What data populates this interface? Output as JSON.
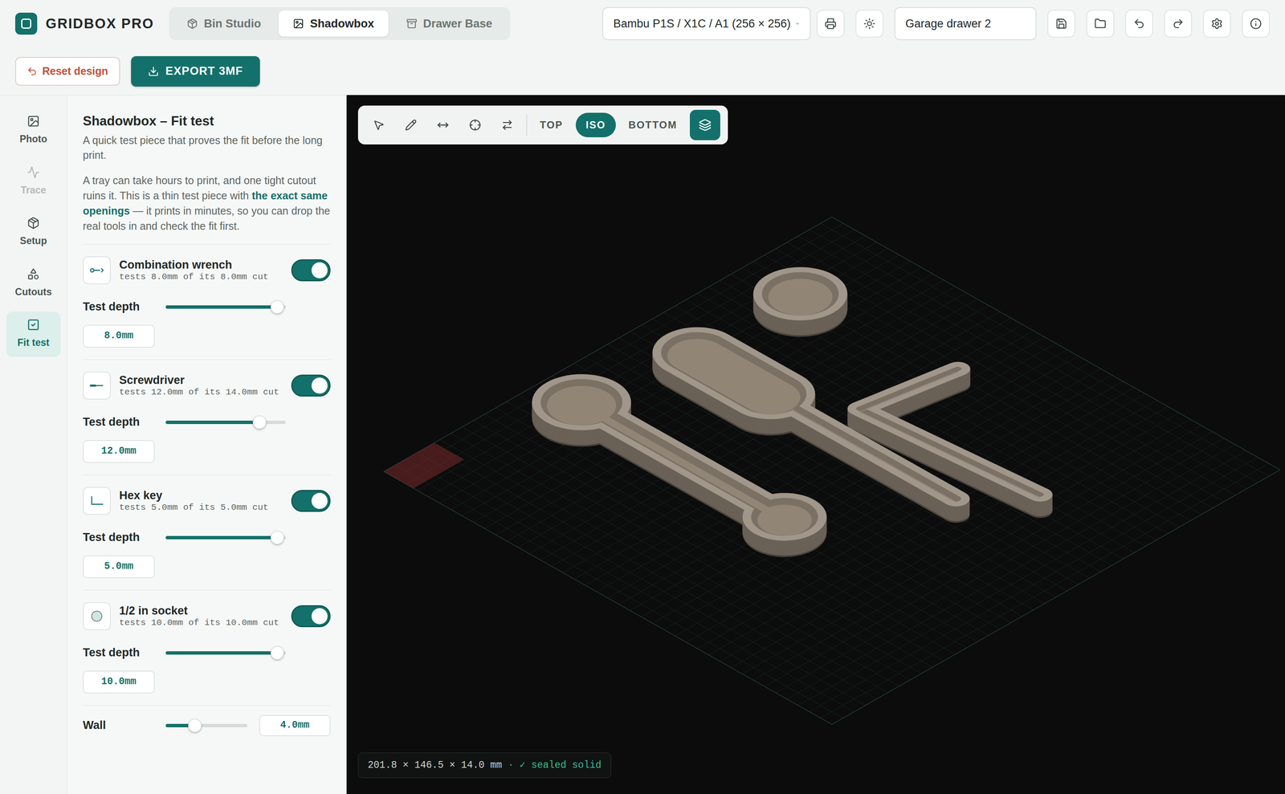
{
  "app": {
    "name": "GRIDBOX PRO"
  },
  "modes": [
    {
      "label": "Bin Studio",
      "selected": false
    },
    {
      "label": "Shadowbox",
      "selected": true
    },
    {
      "label": "Drawer Base",
      "selected": false
    }
  ],
  "printer": {
    "value": "Bambu P1S / X1C / A1 (256 × 256)"
  },
  "project": {
    "name": "Garage drawer 2"
  },
  "actions": {
    "reset": "Reset design",
    "export": "EXPORT 3MF"
  },
  "rail": [
    {
      "label": "Photo",
      "selected": false,
      "disabled": false
    },
    {
      "label": "Trace",
      "selected": false,
      "disabled": true
    },
    {
      "label": "Setup",
      "selected": false,
      "disabled": false
    },
    {
      "label": "Cutouts",
      "selected": false,
      "disabled": false
    },
    {
      "label": "Fit test",
      "selected": true,
      "disabled": false
    }
  ],
  "panel": {
    "title": "Shadowbox – Fit test",
    "subtitle": "A quick test piece that proves the fit before the long print.",
    "intro_before": "A tray can take hours to print, and one tight cutout ruins it. This is a thin test piece with ",
    "intro_highlight": "the exact same openings",
    "intro_after": " — it prints in minutes, so you can drop the real tools in and check the fit first.",
    "depth_label": "Test depth",
    "items": [
      {
        "name": "Combination wrench",
        "detail": "tests 8.0mm of its 8.0mm cut",
        "on": true,
        "level": 0.93,
        "value": "8.0mm"
      },
      {
        "name": "Screwdriver",
        "detail": "tests 12.0mm of its 14.0mm cut",
        "on": true,
        "level": 0.78,
        "value": "12.0mm"
      },
      {
        "name": "Hex key",
        "detail": "tests 5.0mm of its 5.0mm cut",
        "on": true,
        "level": 0.93,
        "value": "5.0mm"
      },
      {
        "name": "1/2 in socket",
        "detail": "tests 10.0mm of its 10.0mm cut",
        "on": true,
        "level": 0.93,
        "value": "10.0mm"
      }
    ],
    "wall": {
      "label": "Wall",
      "level": 0.36,
      "value": "4.0mm"
    }
  },
  "viewport": {
    "views": [
      {
        "label": "TOP",
        "selected": false
      },
      {
        "label": "ISO",
        "selected": true
      },
      {
        "label": "BOTTOM",
        "selected": false
      }
    ],
    "status": {
      "dimensions": "201.8 × 146.5 × 14.0 mm",
      "separator": "·",
      "check": "✓ sealed solid"
    }
  }
}
